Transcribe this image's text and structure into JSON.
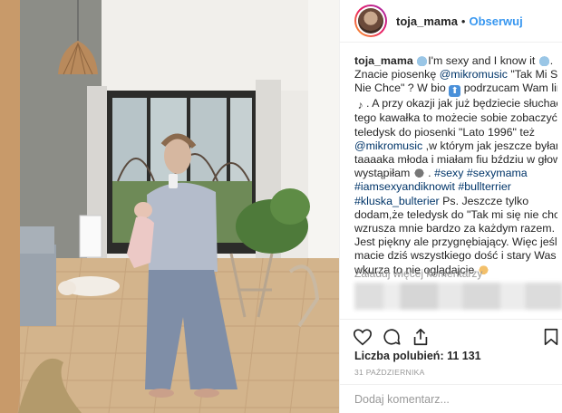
{
  "post": {
    "username": "toja_mama",
    "follow_label": "Obserwuj",
    "separator": "•",
    "caption_lines": [
      {
        "parts": [
          {
            "t": "username",
            "v": "toja_mama"
          },
          {
            "t": "text",
            "v": " "
          },
          {
            "t": "emoji",
            "v": "whale"
          },
          {
            "t": "text",
            "v": "I'm sexy and I know it "
          },
          {
            "t": "emoji",
            "v": "whale"
          },
          {
            "t": "text",
            "v": "."
          }
        ]
      },
      {
        "parts": [
          {
            "t": "text",
            "v": "Znacie piosenkę "
          },
          {
            "t": "tag",
            "v": "@mikromusic"
          },
          {
            "t": "text",
            "v": " \"Tak Mi Się"
          }
        ]
      },
      {
        "parts": [
          {
            "t": "text",
            "v": "Nie Chce\" ? W bio "
          },
          {
            "t": "emoji",
            "v": "up"
          },
          {
            "t": "text",
            "v": " podrzucam Wam link"
          }
        ]
      },
      {
        "parts": [
          {
            "t": "emoji",
            "v": "note"
          },
          {
            "t": "text",
            "v": ". A przy okazji jak już będziecie słuchać"
          }
        ]
      },
      {
        "parts": [
          {
            "t": "text",
            "v": "tego kawałka to możecie sobie zobaczyć"
          }
        ]
      },
      {
        "parts": [
          {
            "t": "text",
            "v": "teledysk do piosenki \"Lato 1996\" też"
          }
        ]
      },
      {
        "parts": [
          {
            "t": "tag",
            "v": "@mikromusic"
          },
          {
            "t": "text",
            "v": " ,w którym jak jeszcze byłam"
          }
        ]
      },
      {
        "parts": [
          {
            "t": "text",
            "v": "taaaaka młoda i miałam fiu bździu w głowie"
          }
        ]
      },
      {
        "parts": [
          {
            "t": "text",
            "v": "wystąpiłam "
          },
          {
            "t": "emoji",
            "v": "ram"
          },
          {
            "t": "text",
            "v": " . "
          },
          {
            "t": "tag",
            "v": "#sexy"
          },
          {
            "t": "text",
            "v": " "
          },
          {
            "t": "tag",
            "v": "#sexymama"
          }
        ]
      },
      {
        "parts": [
          {
            "t": "tag",
            "v": "#iamsexyandiknowit"
          },
          {
            "t": "text",
            "v": " "
          },
          {
            "t": "tag",
            "v": "#bullterrier"
          }
        ]
      },
      {
        "parts": [
          {
            "t": "tag",
            "v": "#kluska_bulterier"
          },
          {
            "t": "text",
            "v": " Ps. Jeszcze tylko"
          }
        ]
      },
      {
        "parts": [
          {
            "t": "text",
            "v": "dodam,że teledysk do \"Tak mi się nie chce\""
          }
        ]
      },
      {
        "parts": [
          {
            "t": "text",
            "v": "wzrusza mnie bardzo za każdym razem."
          }
        ]
      },
      {
        "parts": [
          {
            "t": "text",
            "v": "Jest piękny ale przygnębiający. Więc jeśli"
          }
        ]
      },
      {
        "parts": [
          {
            "t": "text",
            "v": "macie dziś wszystkiego dość i stary Was"
          }
        ]
      },
      {
        "parts": [
          {
            "t": "text",
            "v": "wkurza to nie oglądajcie "
          },
          {
            "t": "emoji",
            "v": "hands"
          }
        ]
      }
    ],
    "load_more_label": "Załaduj więcej komentarzy",
    "likes_label": "Liczba polubień: 11 131",
    "date_label": "31 PAŹDZIERNIKA",
    "comment_placeholder": "Dodaj komentarz...",
    "icons": [
      "heart-icon",
      "comment-icon",
      "share-icon",
      "bookmark-icon"
    ],
    "colors": {
      "link": "#3897f0",
      "hashtag": "#003569",
      "muted": "#999999",
      "text": "#262626"
    }
  }
}
